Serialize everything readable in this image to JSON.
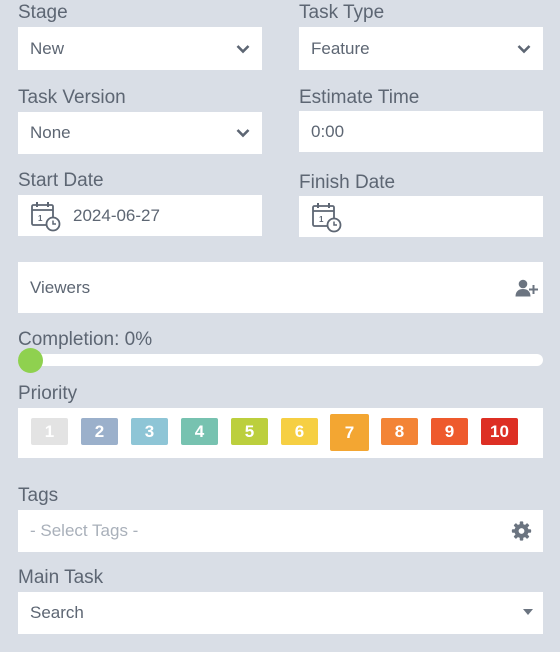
{
  "stage": {
    "label": "Stage",
    "value": "New"
  },
  "task_type": {
    "label": "Task Type",
    "value": "Feature"
  },
  "task_version": {
    "label": "Task Version",
    "value": "None"
  },
  "estimate_time": {
    "label": "Estimate Time",
    "value": "0:00"
  },
  "start_date": {
    "label": "Start Date",
    "value": "2024-06-27"
  },
  "finish_date": {
    "label": "Finish Date",
    "value": ""
  },
  "viewers": {
    "placeholder": "Viewers",
    "icon": "add-user-icon"
  },
  "completion": {
    "label": "Completion: 0%",
    "value": 0
  },
  "priority": {
    "label": "Priority",
    "selected": "7",
    "items": [
      {
        "label": "1",
        "color": "#e3e3e3"
      },
      {
        "label": "2",
        "color": "#9bb0cb"
      },
      {
        "label": "3",
        "color": "#8ec5d6"
      },
      {
        "label": "4",
        "color": "#77c2b0"
      },
      {
        "label": "5",
        "color": "#bccf3d"
      },
      {
        "label": "6",
        "color": "#f6cf43"
      },
      {
        "label": "7",
        "color": "#f3a632"
      },
      {
        "label": "8",
        "color": "#f38436"
      },
      {
        "label": "9",
        "color": "#ee5a2d"
      },
      {
        "label": "10",
        "color": "#dd2f24"
      }
    ]
  },
  "tags": {
    "label": "Tags",
    "placeholder": "- Select Tags -",
    "icon": "gear-icon"
  },
  "main_task": {
    "label": "Main Task",
    "placeholder": "Search"
  },
  "colors": {
    "background": "#d9dee6",
    "text": "#5d6673",
    "slider_thumb": "#8fd14f"
  }
}
